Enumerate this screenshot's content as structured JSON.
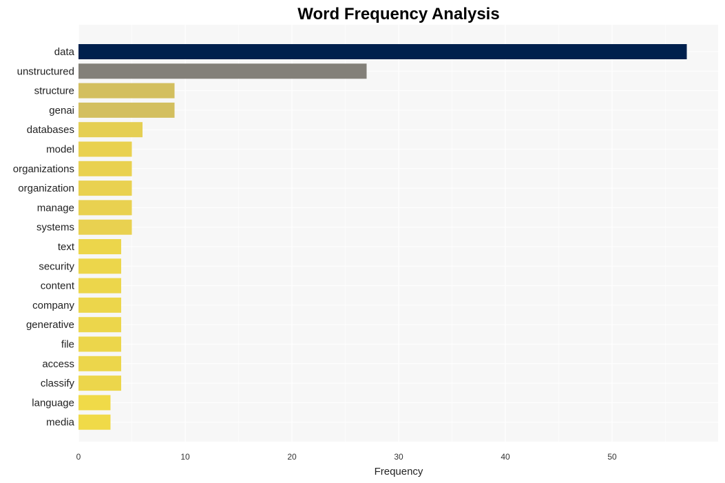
{
  "chart_data": {
    "type": "bar",
    "orientation": "horizontal",
    "title": "Word Frequency Analysis",
    "xlabel": "Frequency",
    "ylabel": "",
    "xlim": [
      0,
      58.5
    ],
    "xticks": [
      0,
      10,
      20,
      30,
      40,
      50
    ],
    "grid": true,
    "categories": [
      "data",
      "unstructured",
      "structure",
      "genai",
      "databases",
      "model",
      "organizations",
      "organization",
      "manage",
      "systems",
      "text",
      "security",
      "content",
      "company",
      "generative",
      "file",
      "access",
      "classify",
      "language",
      "media"
    ],
    "values": [
      57,
      27,
      9,
      9,
      6,
      5,
      5,
      5,
      5,
      5,
      4,
      4,
      4,
      4,
      4,
      4,
      4,
      4,
      3,
      3
    ],
    "colors": [
      "#00204d",
      "#838079",
      "#d3bf5f",
      "#d3bf5f",
      "#e5cf53",
      "#e9d150",
      "#e9d150",
      "#e9d150",
      "#e9d150",
      "#e9d150",
      "#ecd64b",
      "#ecd64b",
      "#ecd64b",
      "#ecd64b",
      "#ecd64b",
      "#ecd64b",
      "#ecd64b",
      "#ecd64b",
      "#f0da48",
      "#f0da48"
    ],
    "background": "#f7f7f7"
  }
}
